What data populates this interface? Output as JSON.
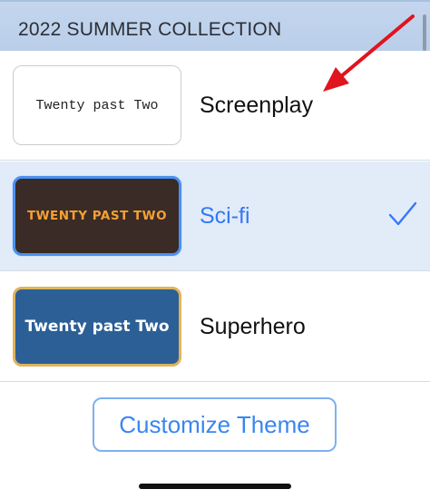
{
  "section": {
    "title": "2022 SUMMER COLLECTION"
  },
  "themes": [
    {
      "label": "Screenplay",
      "preview_text": "Twenty past Two",
      "selected": false
    },
    {
      "label": "Sci-fi",
      "preview_text": "TWENTY PAST TWO",
      "selected": true
    },
    {
      "label": "Superhero",
      "preview_text": "Twenty past Two",
      "selected": false
    }
  ],
  "customize_button": {
    "label": "Customize Theme"
  },
  "colors": {
    "accent": "#3478f6",
    "selected_row": "#e2ecf9",
    "header": "#c4d6ee",
    "annotation_arrow": "#e0141e"
  },
  "icons": {
    "selected_indicator": "checkmark-icon",
    "annotation": "red-arrow"
  }
}
